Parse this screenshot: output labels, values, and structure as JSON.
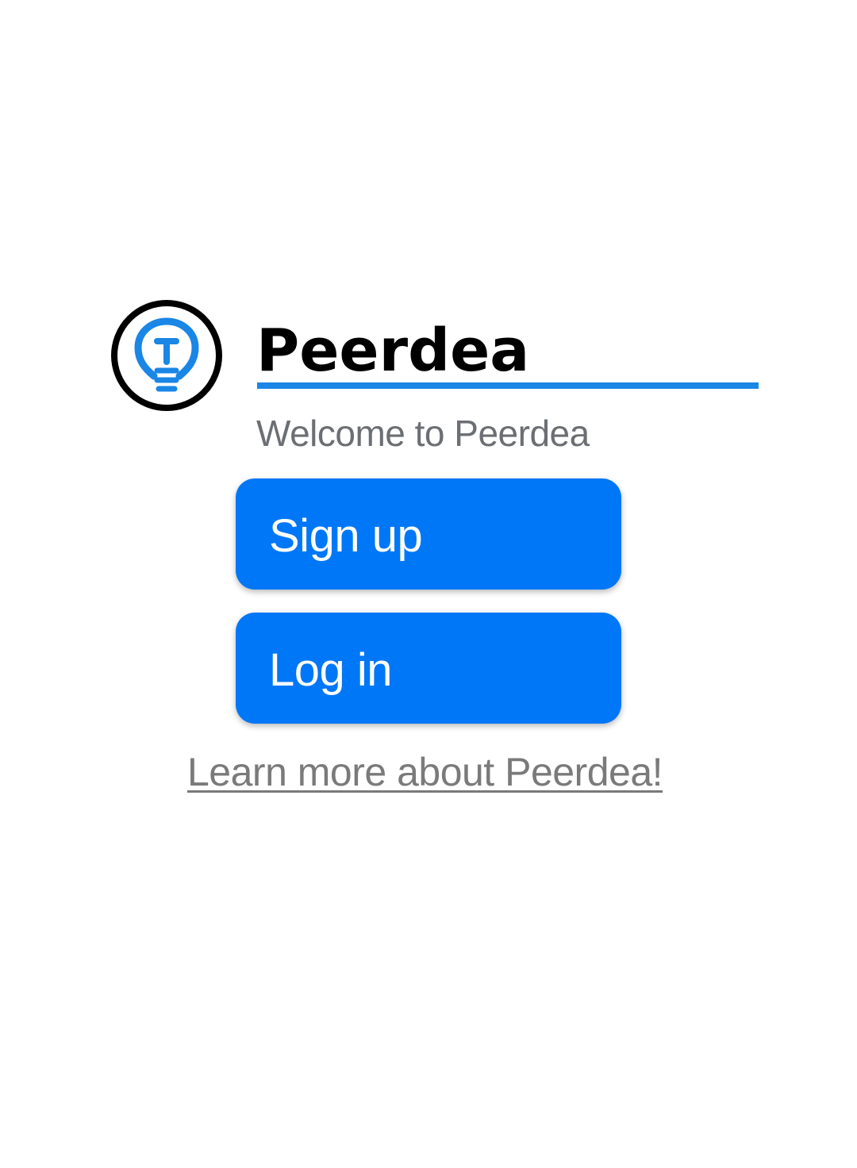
{
  "brand": {
    "name": "Peerdea",
    "logo_icon": "lightbulb-icon",
    "accent_color": "#1a86e6"
  },
  "welcome_text": "Welcome to Peerdea",
  "actions": {
    "signup_label": "Sign up",
    "login_label": "Log in",
    "button_color": "#0077f7"
  },
  "learn_more_link": "Learn more about Peerdea!"
}
